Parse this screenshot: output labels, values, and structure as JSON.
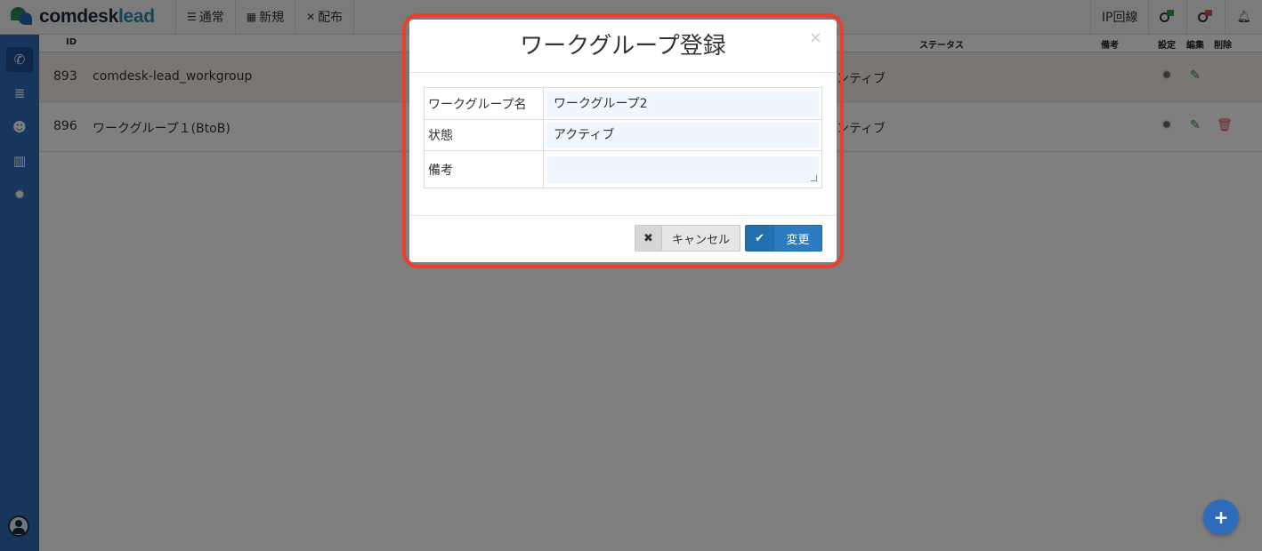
{
  "app": {
    "brand_main": "comdesk",
    "brand_accent": "lead",
    "accent_color": "#2f6bbb"
  },
  "topnav": {
    "items": [
      {
        "icon": "list-icon",
        "label": "通常"
      },
      {
        "icon": "grid-icon",
        "label": "新規"
      },
      {
        "icon": "distribute-icon",
        "label": "配布"
      }
    ],
    "ip_line_label": "IP回線"
  },
  "table": {
    "headers": {
      "id": "ID",
      "status": "ステータス",
      "note": "備考",
      "settings": "設定",
      "edit": "編集",
      "delete": "削除"
    },
    "rows": [
      {
        "id": "893",
        "name": "comdesk-lead_workgroup",
        "status": "ンティブ"
      },
      {
        "id": "896",
        "name": "ワークグループ１(BtoB)",
        "status": "ンティブ"
      }
    ]
  },
  "modal": {
    "title": "ワークグループ登録",
    "close": "×",
    "fields": {
      "name_label": "ワークグループ名",
      "name_value": "ワークグループ2",
      "state_label": "状態",
      "state_value": "アクティブ",
      "note_label": "備考",
      "note_value": ""
    },
    "cancel_icon": "✖",
    "cancel_label": "キャンセル",
    "submit_icon": "✔",
    "submit_label": "変更"
  },
  "fab": {
    "label": "+"
  }
}
